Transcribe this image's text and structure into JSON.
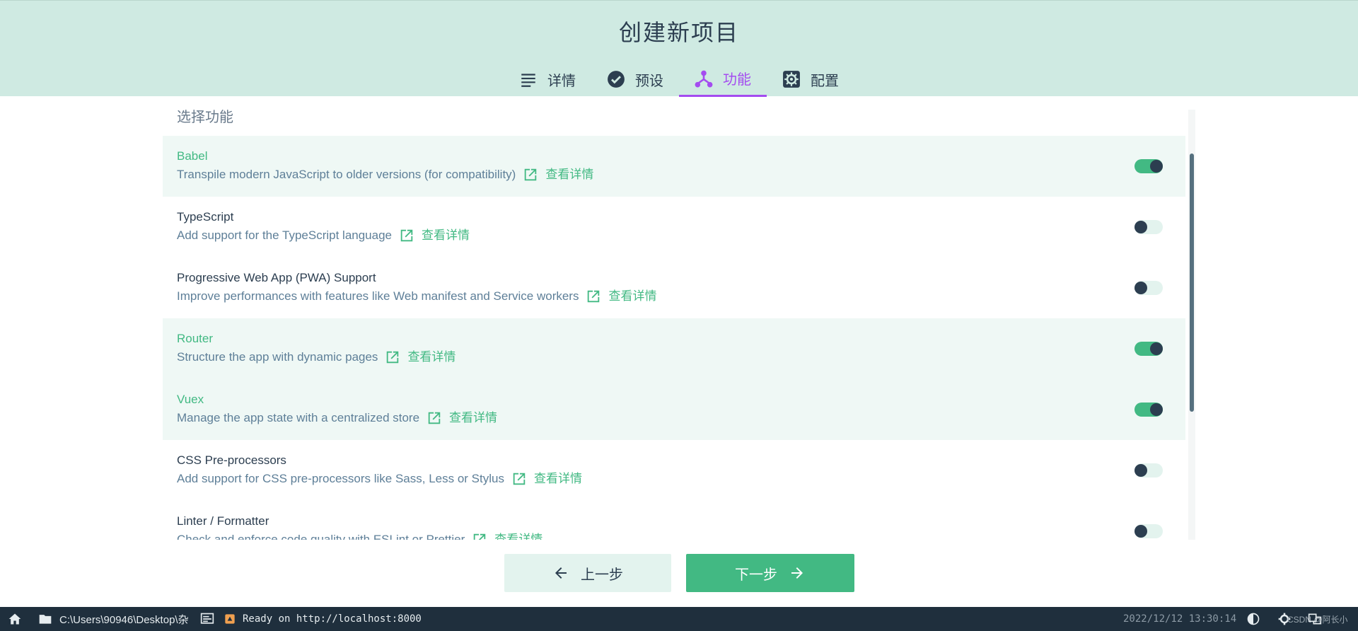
{
  "header": {
    "title": "创建新项目",
    "tabs": [
      {
        "label": "详情",
        "icon": "list-icon",
        "active": false
      },
      {
        "label": "预设",
        "icon": "check-circle-icon",
        "active": false
      },
      {
        "label": "功能",
        "icon": "fork-icon",
        "active": true
      },
      {
        "label": "配置",
        "icon": "gear-icon",
        "active": false
      }
    ]
  },
  "section_title": "选择功能",
  "more_label": "查看详情",
  "features": [
    {
      "name": "Babel",
      "desc": "Transpile modern JavaScript to older versions (for compatibility)",
      "enabled": true
    },
    {
      "name": "TypeScript",
      "desc": "Add support for the TypeScript language",
      "enabled": false
    },
    {
      "name": "Progressive Web App (PWA) Support",
      "desc": "Improve performances with features like Web manifest and Service workers",
      "enabled": false
    },
    {
      "name": "Router",
      "desc": "Structure the app with dynamic pages",
      "enabled": true
    },
    {
      "name": "Vuex",
      "desc": "Manage the app state with a centralized store",
      "enabled": true
    },
    {
      "name": "CSS Pre-processors",
      "desc": "Add support for CSS pre-processors like Sass, Less or Stylus",
      "enabled": false
    },
    {
      "name": "Linter / Formatter",
      "desc": "Check and enforce code quality with ESLint or Prettier",
      "enabled": false
    }
  ],
  "buttons": {
    "prev": "上一步",
    "next": "下一步"
  },
  "statusbar": {
    "path": "C:\\Users\\90946\\Desktop\\杂",
    "status": "Ready on http://localhost:8000",
    "datetime": "2022/12/12 13:30:14",
    "watermark": "CSDN @阿长小"
  },
  "colors": {
    "accent": "#42b983",
    "active_tab": "#a44cf0",
    "header_bg": "#cfeae2",
    "text": "#2c3e50",
    "statusbar_bg": "#1f2f3d"
  }
}
